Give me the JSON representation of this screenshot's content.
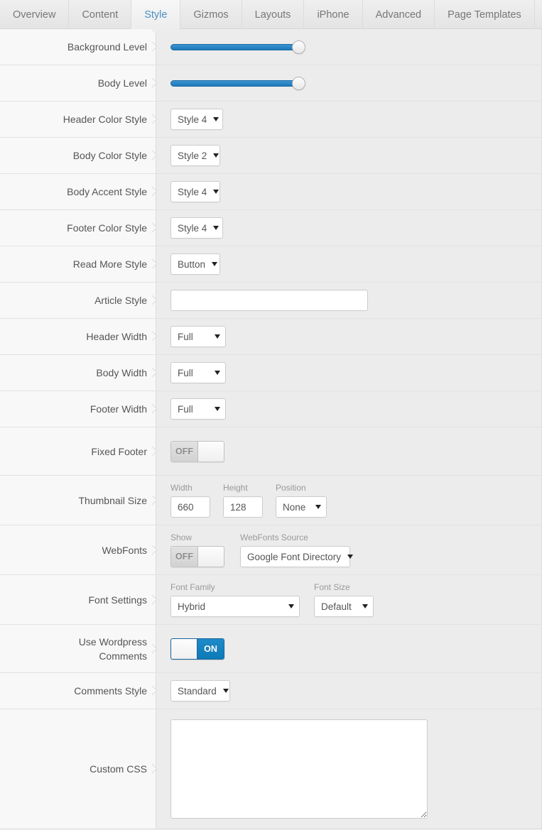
{
  "tabs": [
    {
      "label": "Overview",
      "active": false
    },
    {
      "label": "Content",
      "active": false
    },
    {
      "label": "Style",
      "active": true
    },
    {
      "label": "Gizmos",
      "active": false
    },
    {
      "label": "Layouts",
      "active": false
    },
    {
      "label": "iPhone",
      "active": false
    },
    {
      "label": "Advanced",
      "active": false
    },
    {
      "label": "Page Templates",
      "active": false
    }
  ],
  "colors": {
    "accent_blue": "#1e8bc9",
    "active_tab_text": "#4a90c4",
    "label_column_bg": "#f8f8f8",
    "control_column_bg": "#ececec",
    "slider_fill": "#2a85c2"
  },
  "rows": {
    "background_level": {
      "label": "Background Level",
      "type": "slider",
      "value": 95
    },
    "body_level": {
      "label": "Body Level",
      "type": "slider",
      "value": 95
    },
    "header_color_style": {
      "label": "Header Color Style",
      "value": "Style 4"
    },
    "body_color_style": {
      "label": "Body Color Style",
      "value": "Style 2"
    },
    "body_accent_style": {
      "label": "Body Accent Style",
      "value": "Style 4"
    },
    "footer_color_style": {
      "label": "Footer Color Style",
      "value": "Style 4"
    },
    "read_more_style": {
      "label": "Read More Style",
      "value": "Button"
    },
    "article_style": {
      "label": "Article Style",
      "value": "",
      "placeholder": ""
    },
    "header_width": {
      "label": "Header Width",
      "value": "Full"
    },
    "body_width": {
      "label": "Body Width",
      "value": "Full"
    },
    "footer_width": {
      "label": "Footer Width",
      "value": "Full"
    },
    "fixed_footer": {
      "label": "Fixed Footer",
      "state": "OFF"
    },
    "thumbnail_size": {
      "label": "Thumbnail Size",
      "width": {
        "sub": "Width",
        "value": "660"
      },
      "height": {
        "sub": "Height",
        "value": "128"
      },
      "position": {
        "sub": "Position",
        "value": "None"
      }
    },
    "webfonts": {
      "label": "WebFonts",
      "show": {
        "sub": "Show",
        "state": "OFF"
      },
      "source": {
        "sub": "WebFonts Source",
        "value": "Google Font Directory"
      }
    },
    "font_settings": {
      "label": "Font Settings",
      "family": {
        "sub": "Font Family",
        "value": "Hybrid"
      },
      "size": {
        "sub": "Font Size",
        "value": "Default"
      }
    },
    "use_wordpress_comments": {
      "label": "Use Wordpress\nComments",
      "label_line1": "Use Wordpress",
      "label_line2": "Comments",
      "state": "ON"
    },
    "comments_style": {
      "label": "Comments Style",
      "value": "Standard"
    },
    "custom_css": {
      "label": "Custom CSS",
      "value": "",
      "placeholder": ""
    }
  }
}
